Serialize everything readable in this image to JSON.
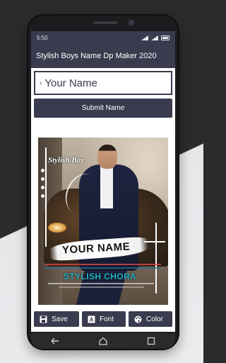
{
  "status_bar": {
    "time": "5:50"
  },
  "app_bar": {
    "title": "Stylish Boys Name Dp Maker 2020"
  },
  "name_input": {
    "value": "Your Name"
  },
  "submit_button": {
    "label": "Submit Name"
  },
  "photo": {
    "badge_text": "Stylish Boy",
    "name_text": "YOUR NAME",
    "subtitle_text": "STYLISH CHORA"
  },
  "toolbar": {
    "save_label": "Save",
    "font_label": "Font",
    "color_label": "Color"
  },
  "icons": {
    "save": "save-icon",
    "font": "font-icon",
    "color": "palette-icon",
    "back": "back-icon",
    "home": "home-icon",
    "recents": "recents-icon"
  },
  "colors": {
    "primary": "#3b3b4f",
    "accent_text": "#25b4c8"
  }
}
